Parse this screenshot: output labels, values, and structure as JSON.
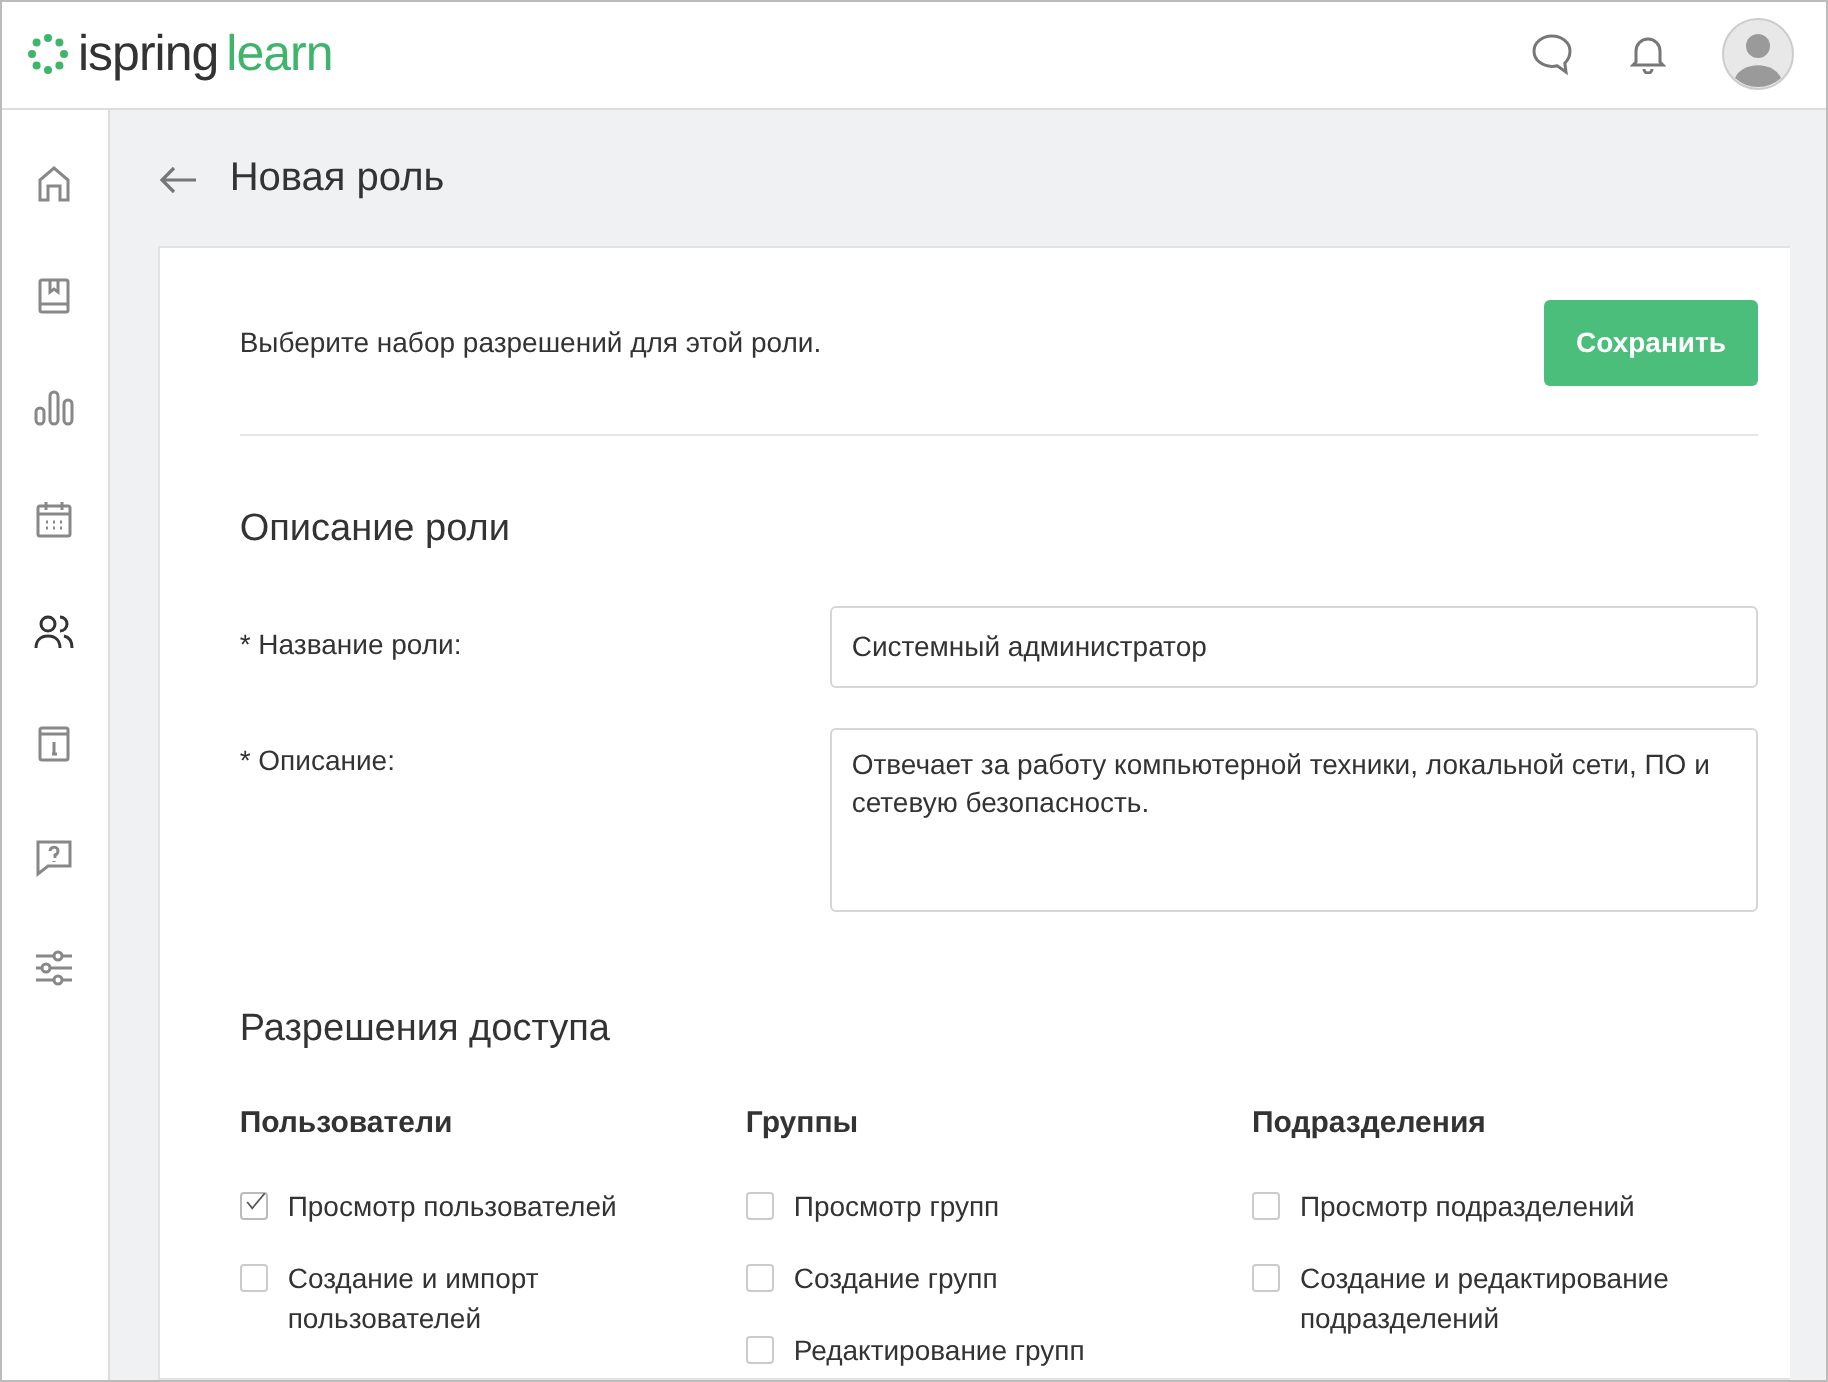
{
  "header": {
    "logo_word_1": "ispring",
    "logo_word_2": "learn"
  },
  "sidebar": {
    "items": [
      {
        "selected": false
      },
      {
        "selected": false
      },
      {
        "selected": false
      },
      {
        "selected": false
      },
      {
        "selected": true
      },
      {
        "selected": false
      },
      {
        "selected": false
      },
      {
        "selected": false
      }
    ]
  },
  "page": {
    "title": "Новая роль"
  },
  "intro": "Выберите набор разрешений для этой роли.",
  "save_button": "Сохранить",
  "description_section": {
    "title": "Описание роли",
    "fields": [
      {
        "kind": "input",
        "label": "* Название роли:",
        "value": "Системный администратор"
      },
      {
        "kind": "textarea",
        "label": "* Описание:",
        "value": "Отвечает за работу компьютерной техники, локальной сети, ПО и сетевую безопасность."
      }
    ]
  },
  "permissions_section": {
    "title": "Разрешения доступа",
    "groups": [
      {
        "title": "Пользователи",
        "items": [
          {
            "label": "Просмотр пользователей",
            "checked": true
          },
          {
            "label": "Создание и импорт пользователей",
            "checked": false
          }
        ]
      },
      {
        "title": "Группы",
        "items": [
          {
            "label": "Просмотр групп",
            "checked": false
          },
          {
            "label": "Создание групп",
            "checked": false
          },
          {
            "label": "Редактирование групп",
            "checked": false
          }
        ]
      },
      {
        "title": "Подразделения",
        "items": [
          {
            "label": "Просмотр подразделений",
            "checked": false
          },
          {
            "label": "Создание и редактирование подразделений",
            "checked": false
          }
        ]
      }
    ]
  }
}
